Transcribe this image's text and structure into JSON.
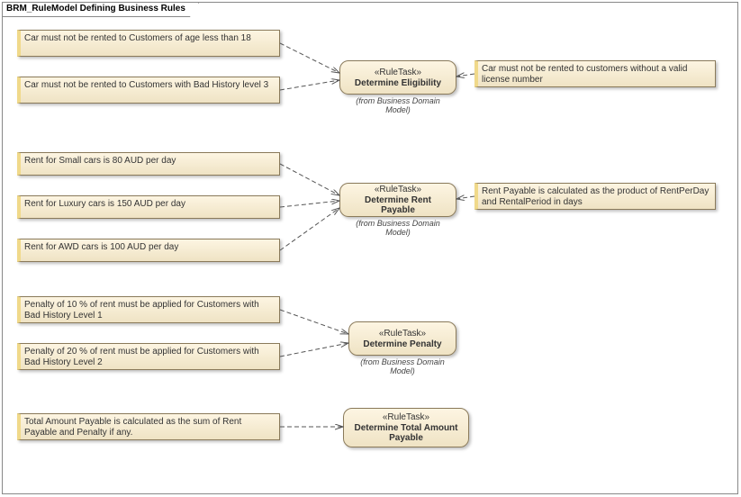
{
  "frame": {
    "title": "BRM_RuleModel Defining Business Rules"
  },
  "stereotype": "«RuleTask»",
  "from_label": "(from Business Domain Model)",
  "tasks": {
    "eligibility": {
      "name": "Determine Eligibility"
    },
    "rent": {
      "name": "Determine Rent Payable"
    },
    "penalty": {
      "name": "Determine Penalty"
    },
    "total": {
      "name": "Determine Total Amount Payable"
    }
  },
  "rules": {
    "age18": "Car must not be rented to Customers of age less than 18",
    "badhist3": "Car must not be rented to Customers with Bad History level 3",
    "license": "Car must not be rented to customers without a valid license number",
    "small": "Rent for Small cars is 80 AUD per day",
    "luxury": "Rent for Luxury cars is 150 AUD per day",
    "awd": "Rent for AWD cars is 100 AUD per day",
    "rentcalc": "Rent Payable is calculated as the product of RentPerDay and RentalPeriod in days",
    "penalty1": "Penalty of 10 % of rent must be applied for Customers with Bad History Level 1",
    "penalty2": "Penalty of 20 % of rent must be applied for Customers with Bad History Level 2",
    "totalcalc": "Total Amount Payable is calculated as the sum of Rent Payable and Penalty if any."
  }
}
